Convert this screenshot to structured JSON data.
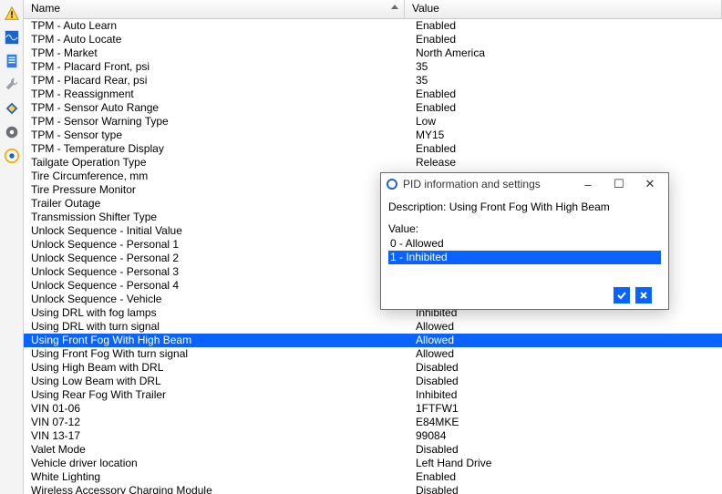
{
  "headers": {
    "name": "Name",
    "value": "Value"
  },
  "toolbar_icons": [
    "warning",
    "wave",
    "page",
    "wrench",
    "diamond",
    "gear",
    "target"
  ],
  "rows": [
    {
      "n": "TPM - Auto Learn",
      "v": "Enabled"
    },
    {
      "n": "TPM - Auto Locate",
      "v": "Enabled"
    },
    {
      "n": "TPM - Market",
      "v": "North America"
    },
    {
      "n": "TPM - Placard Front, psi",
      "v": "35"
    },
    {
      "n": "TPM - Placard Rear, psi",
      "v": "35"
    },
    {
      "n": "TPM - Reassignment",
      "v": "Enabled"
    },
    {
      "n": "TPM - Sensor Auto Range",
      "v": "Enabled"
    },
    {
      "n": "TPM - Sensor Warning Type",
      "v": "Low"
    },
    {
      "n": "TPM - Sensor type",
      "v": "MY15"
    },
    {
      "n": "TPM - Temperature Display",
      "v": "Enabled"
    },
    {
      "n": "Tailgate Operation Type",
      "v": "Release"
    },
    {
      "n": "Tire Circumference, mm",
      "v": ""
    },
    {
      "n": "Tire Pressure Monitor",
      "v": ""
    },
    {
      "n": "Trailer Outage",
      "v": ""
    },
    {
      "n": "Transmission Shifter Type",
      "v": ""
    },
    {
      "n": "Unlock Sequence - Initial Value",
      "v": ""
    },
    {
      "n": "Unlock Sequence - Personal 1",
      "v": ""
    },
    {
      "n": "Unlock Sequence - Personal 2",
      "v": ""
    },
    {
      "n": "Unlock Sequence - Personal 3",
      "v": ""
    },
    {
      "n": "Unlock Sequence - Personal 4",
      "v": ""
    },
    {
      "n": "Unlock Sequence - Vehicle",
      "v": ""
    },
    {
      "n": "Using DRL with fog lamps",
      "v": "Inhibited"
    },
    {
      "n": "Using DRL with turn signal",
      "v": "Allowed"
    },
    {
      "n": "Using Front Fog With High Beam",
      "v": "Allowed",
      "sel": true
    },
    {
      "n": "Using Front Fog With turn signal",
      "v": "Allowed"
    },
    {
      "n": "Using High Beam with DRL",
      "v": "Disabled"
    },
    {
      "n": "Using Low Beam with DRL",
      "v": "Disabled"
    },
    {
      "n": "Using Rear Fog With Trailer",
      "v": "Inhibited"
    },
    {
      "n": "VIN 01-06",
      "v": "1FTFW1"
    },
    {
      "n": "VIN 07-12",
      "v": "E84MKE"
    },
    {
      "n": "VIN 13-17",
      "v": "99084"
    },
    {
      "n": "Valet Mode",
      "v": "Disabled"
    },
    {
      "n": "Vehicle driver location",
      "v": "Left Hand Drive"
    },
    {
      "n": "White Lighting",
      "v": "Enabled"
    },
    {
      "n": "Wireless Accessory Charging Module",
      "v": "Disabled"
    }
  ],
  "dialog": {
    "title": "PID information and settings",
    "desc_label": "Description:",
    "desc_value": "Using Front Fog With High Beam",
    "value_label": "Value:",
    "options": [
      {
        "t": "0 - Allowed",
        "sel": false
      },
      {
        "t": "1 - Inhibited",
        "sel": true
      }
    ]
  }
}
